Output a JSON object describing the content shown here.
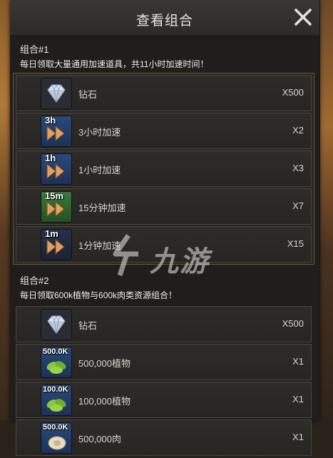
{
  "dialog": {
    "title": "查看组合"
  },
  "groups": [
    {
      "title": "组合#1",
      "description": "每日领取大量通用加速道具，共11小时加速时间！",
      "items": [
        {
          "icon": "diamond-icon",
          "tag": "",
          "name": "钻石",
          "qty": "X500"
        },
        {
          "icon": "speedup-icon",
          "tag": "3h",
          "name": "3小时加速",
          "qty": "X2"
        },
        {
          "icon": "speedup-icon",
          "tag": "1h",
          "name": "1小时加速",
          "qty": "X3"
        },
        {
          "icon": "speedup-icon",
          "tag": "15m",
          "name": "15分钟加速",
          "qty": "X7"
        },
        {
          "icon": "speedup-icon",
          "tag": "1m",
          "name": "1分钟加速",
          "qty": "X15"
        }
      ]
    },
    {
      "title": "组合#2",
      "description": "每日领取600k植物与600k肉类资源组合！",
      "items": [
        {
          "icon": "diamond-icon",
          "tag": "",
          "name": "钻石",
          "qty": "X500"
        },
        {
          "icon": "plant-icon",
          "tag": "500.0K",
          "name": "500,000植物",
          "qty": "X1"
        },
        {
          "icon": "plant-icon",
          "tag": "100.0K",
          "name": "100,000植物",
          "qty": "X1"
        },
        {
          "icon": "meat-icon",
          "tag": "500.0K",
          "name": "500,000肉",
          "qty": "X1"
        }
      ]
    }
  ],
  "watermark": {
    "text": "九游"
  },
  "colors": {
    "panel": "#1f1e1d",
    "border_gold": "#6b5a3a",
    "speedup_orange": "#e0a060"
  }
}
